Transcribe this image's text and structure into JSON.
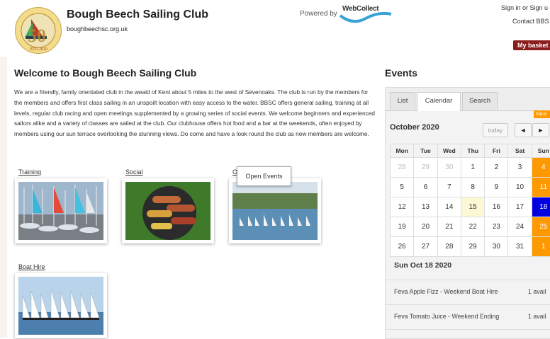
{
  "header": {
    "club_name": "Bough Beech Sailing Club",
    "club_url": "boughbeechsc.org.uk",
    "powered_by": "Powered by",
    "brand_logo_text": "WebCollect",
    "logo_text_top": "BOUGH BEECH SAILING CLUB",
    "logo_year": "50",
    "logo_years": "1970-2020",
    "sign_in": "Sign in or Sign u",
    "contact": "Contact BBS",
    "basket": "My basket"
  },
  "main": {
    "title": "Welcome to Bough Beech Sailing Club",
    "intro": "We are a friendly, family orientated club in the weald of Kent about 5 miles to the west of Sevenoaks. The club is run by the members for the members and offers first class sailing in an unspoilt location with easy access to the water. BBSC offers general sailing, training at all levels, regular club racing and open meetings supplemented by a growing series of social events. We welcome beginners and experienced sailors alike and a variety of classes are sailed at the club. Our clubhouse offers hot food and a bar at the weekends, often enjoyed by members using our sun terrace overlooking the stunning views. Do come and have a look round the club as new members are welcome.",
    "cards": [
      {
        "title": "Training"
      },
      {
        "title": "Social"
      },
      {
        "title": "O"
      },
      {
        "title": "Boat Hire"
      }
    ],
    "tooltip": "Open Events"
  },
  "events": {
    "title": "Events",
    "tabs": [
      "List",
      "Calendar",
      "Search"
    ],
    "active_tab": "Calendar",
    "legend_badge": "mica",
    "month": "October 2020",
    "today_label": "today",
    "prev_icon": "◄",
    "next_icon": "►",
    "weekdays": [
      "Mon",
      "Tue",
      "Wed",
      "Thu",
      "Fri",
      "Sat",
      "Sun"
    ],
    "weeks": [
      [
        "28",
        "29",
        "30",
        "1",
        "2",
        "3",
        "4"
      ],
      [
        "5",
        "6",
        "7",
        "8",
        "9",
        "10",
        "11"
      ],
      [
        "12",
        "13",
        "14",
        "15",
        "16",
        "17",
        "18"
      ],
      [
        "19",
        "20",
        "21",
        "22",
        "23",
        "24",
        "25"
      ],
      [
        "26",
        "27",
        "28",
        "29",
        "30",
        "31",
        "1"
      ]
    ],
    "selected_day_heading": "Sun Oct 18 2020",
    "items": [
      {
        "name": "Feva Apple Fizz - Weekend Boat Hire",
        "avail": "1 avail"
      },
      {
        "name": "Feva Tomato Juice - Weekend Ending",
        "avail": "1 avail"
      }
    ]
  },
  "colors": {
    "weekend_event": "#ff9900",
    "selected_day": "#0000e0",
    "today": "#fcf8d6",
    "basket": "#8b1d1d",
    "brand_wave": "#3aa0d8"
  }
}
